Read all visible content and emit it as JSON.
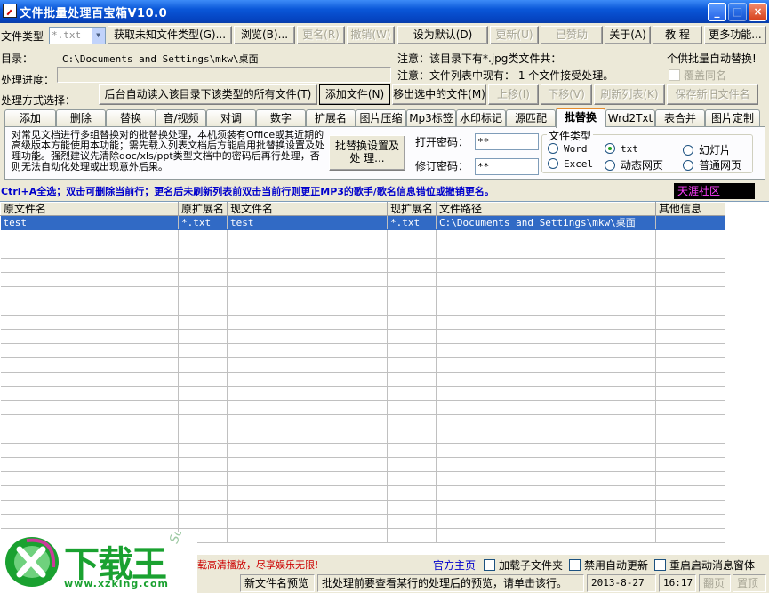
{
  "window": {
    "title": "文件批量处理百宝箱V10.0",
    "min_icon": "_",
    "max_icon": "□",
    "close_icon": "×"
  },
  "toolbar": {
    "file_type_label": "文件类型",
    "file_type_value": "*.txt",
    "dropdown_arrow": "▼",
    "get_unknown": "获取未知文件类型(G)...",
    "browse": "浏览(B)...",
    "rename": "更名(R)",
    "undo": "撤销(W)",
    "set_default": "设为默认(D)",
    "update": "更新(U)",
    "donated": "已赞助",
    "about": "关于(A)",
    "tutorial": "教 程",
    "more": "更多功能..."
  },
  "info": {
    "dir_label": "目录：",
    "dir_value": "C:\\Documents and Settings\\mkw\\桌面",
    "note1": "注意：该目录下有*.jpg类文件共：",
    "note2": "注意：文件列表中现有：  1 个文件接受处理。",
    "batch_auto": "个供批量自动替换!",
    "progress_label": "处理进度：",
    "overwrite": "覆盖同名",
    "method_label": "处理方式选择：",
    "auto_read": "后台自动读入该目录下该类型的所有文件(T)",
    "add_file": "添加文件(N)",
    "remove_selected": "移出选中的文件(M)",
    "move_up": "上移(I)",
    "move_down": "下移(V)",
    "refresh_list": "刷新列表(K)",
    "save_names": "保存新旧文件名"
  },
  "tabs": [
    "添加",
    "删除",
    "替换",
    "音/视频",
    "对调",
    "数字",
    "扩展名",
    "图片压缩",
    "Mp3标签",
    "水印标记",
    "源匹配",
    "批替换",
    "Wrd2Txt",
    "表合并",
    "图片定制"
  ],
  "active_tab": "批替换",
  "panel": {
    "description": "对常见文档进行多组替换对的批替换处理，本机须装有Office或其近期的高级版本方能使用本功能；需先载入列表文档后方能启用批替换设置及处理功能。强烈建议先清除doc/xls/ppt类型文档中的密码后再行处理，否则无法自动化处理或出现意外后果。",
    "settings_button_line1": "批替换设置及",
    "settings_button_line2": "处  理...",
    "open_pwd_label": "打开密码：",
    "open_pwd_value": "**",
    "edit_pwd_label": "修订密码：",
    "edit_pwd_value": "**",
    "file_type_group": "文件类型",
    "radios": [
      {
        "label": "Word",
        "on": false
      },
      {
        "label": "txt",
        "on": true
      },
      {
        "label": "幻灯片",
        "on": false
      },
      {
        "label": "Excel",
        "on": false
      },
      {
        "label": "动态网页",
        "on": false
      },
      {
        "label": "普通网页",
        "on": false
      }
    ]
  },
  "hint": {
    "text": "Ctrl+A全选；双击可删除当前行；更名后未刷新列表前双击当前行则更正MP3的歌手/歌名信息错位或撤销更名。",
    "community": "天涯社区"
  },
  "grid": {
    "columns": [
      "原文件名",
      "原扩展名",
      "现文件名",
      "现扩展名",
      "文件路径",
      "其他信息"
    ],
    "rows": [
      [
        "test",
        "*.txt",
        "test",
        "*.txt",
        "C:\\Documents and Settings\\mkw\\桌面",
        ""
      ]
    ]
  },
  "bottom": {
    "promo": "载高清播放，尽享娱乐无限!",
    "homepage": "官方主页",
    "load_subfolder": "加载子文件夹",
    "disable_update": "禁用自动更新",
    "restart_msg": "重启启动消息窗体"
  },
  "status": {
    "preview": "新文件名预览",
    "hint": "批处理前要查看某行的处理后的预览，请单击该行。",
    "date": "2013-8-27",
    "time": "16:17",
    "page": "翻页",
    "top": "置顶"
  },
  "logo": {
    "brand": "下载王",
    "url": "www.xzking.com",
    "soft": "Soft"
  },
  "colors": {
    "accent": "#316ac5",
    "hint_blue": "#0000cc",
    "promo_red": "#cc0000",
    "logo_green": "#1aa130"
  }
}
